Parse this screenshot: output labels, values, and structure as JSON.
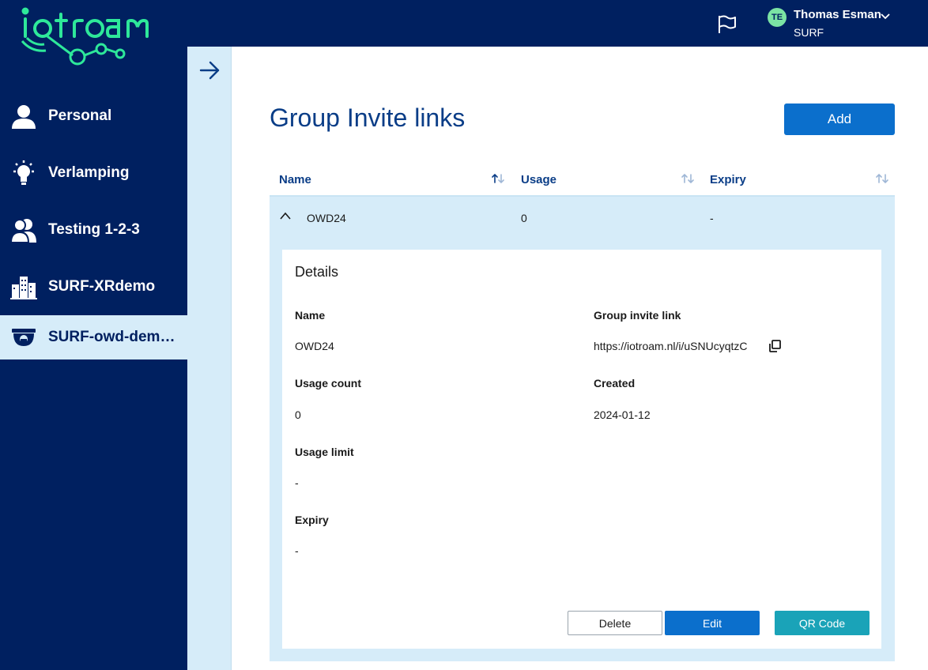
{
  "app": {
    "logo_text": "iotroam"
  },
  "sidebar": {
    "items": [
      {
        "label": "Personal",
        "icon": "person-icon"
      },
      {
        "label": "Verlamping",
        "icon": "lightbulb-icon"
      },
      {
        "label": "Testing 1-2-3",
        "icon": "group-icon"
      },
      {
        "label": "SURF-XRdemo",
        "icon": "buildings-icon"
      },
      {
        "label": "SURF-owd-demo...",
        "icon": "camera-icon",
        "active": true
      }
    ]
  },
  "topbar": {
    "user_initials": "TE",
    "user_name": "Thomas Esman",
    "user_org": "SURF"
  },
  "page": {
    "title": "Group Invite links",
    "add_label": "Add"
  },
  "table": {
    "columns": [
      "Name",
      "Usage",
      "Expiry"
    ],
    "rows": [
      {
        "name": "OWD24",
        "usage": "0",
        "expiry": "-"
      }
    ]
  },
  "details": {
    "title": "Details",
    "name_label": "Name",
    "name_value": "OWD24",
    "link_label": "Group invite link",
    "link_value": "https://iotroam.nl/i/uSNUcyqtzC",
    "usage_count_label": "Usage count",
    "usage_count_value": "0",
    "created_label": "Created",
    "created_value": "2024-01-12",
    "usage_limit_label": "Usage limit",
    "usage_limit_value": "-",
    "expiry_label": "Expiry",
    "expiry_value": "-",
    "delete_label": "Delete",
    "edit_label": "Edit",
    "qr_label": "QR Code"
  },
  "colors": {
    "navy": "#002060",
    "accent_green": "#2ee89a",
    "light_blue": "#d6ecf9",
    "primary_button": "#0b6fcc",
    "teal_button": "#1aa3b8",
    "title_blue": "#0a3d87"
  }
}
